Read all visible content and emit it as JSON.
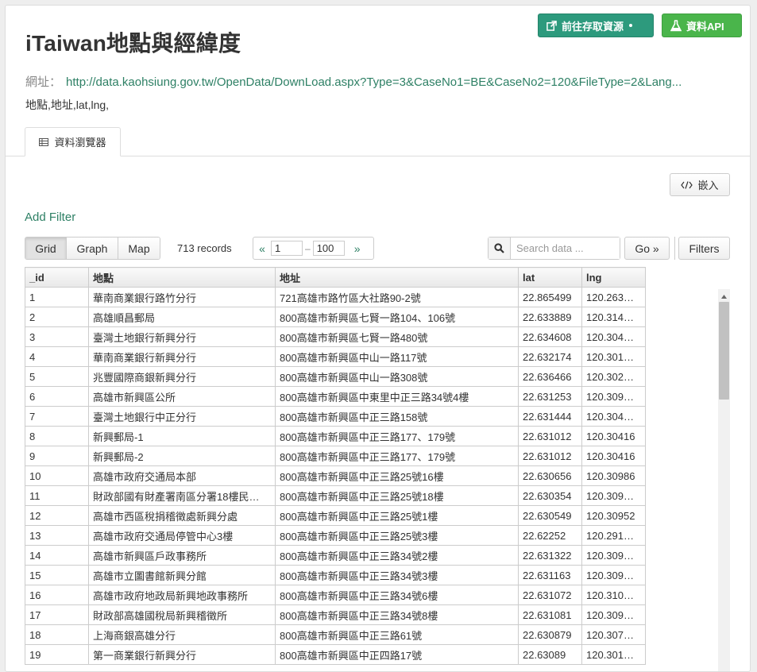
{
  "page": {
    "title": "iTaiwan地點與經緯度",
    "url_label": "網址：",
    "url": "http://data.kaohsiung.gov.tw/OpenData/DownLoad.aspx?Type=3&CaseNo1=BE&CaseNo2=120&FileType=2&Lang...",
    "fields": "地點,地址,lat,lng,"
  },
  "buttons": {
    "access": "前往存取資源",
    "api": "資料API",
    "embed": "嵌入",
    "go": "Go »",
    "filters": "Filters"
  },
  "tabs": {
    "data_explorer": "資料瀏覽器"
  },
  "toolbar": {
    "add_filter": "Add Filter",
    "views": [
      "Grid",
      "Graph",
      "Map"
    ],
    "records": "713 records",
    "pager_prev": "«",
    "pager_next": "»",
    "pager_from": "1",
    "pager_dash": "–",
    "pager_to": "100",
    "search_placeholder": "Search data ..."
  },
  "grid": {
    "columns": [
      "_id",
      "地點",
      "地址",
      "lat",
      "lng"
    ],
    "rows": [
      [
        "1",
        "華南商業銀行路竹分行",
        "721高雄市路竹區大社路90-2號",
        "22.865499",
        "120.263…"
      ],
      [
        "2",
        "高雄順昌郵局",
        "800高雄市新興區七賢一路104、106號",
        "22.633889",
        "120.314…"
      ],
      [
        "3",
        "臺灣土地銀行新興分行",
        "800高雄市新興區七賢一路480號",
        "22.634608",
        "120.304…"
      ],
      [
        "4",
        "華南商業銀行新興分行",
        "800高雄市新興區中山一路117號",
        "22.632174",
        "120.301…"
      ],
      [
        "5",
        "兆豐國際商銀新興分行",
        "800高雄市新興區中山一路308號",
        "22.636466",
        "120.302…"
      ],
      [
        "6",
        "高雄市新興區公所",
        "800高雄市新興區中東里中正三路34號4樓",
        "22.631253",
        "120.309…"
      ],
      [
        "7",
        "臺灣土地銀行中正分行",
        "800高雄市新興區中正三路158號",
        "22.631444",
        "120.304…"
      ],
      [
        "8",
        "新興郵局-1",
        "800高雄市新興區中正三路177、179號",
        "22.631012",
        "120.30416"
      ],
      [
        "9",
        "新興郵局-2",
        "800高雄市新興區中正三路177、179號",
        "22.631012",
        "120.30416"
      ],
      [
        "10",
        "高雄市政府交通局本部",
        "800高雄市新興區中正三路25號16樓",
        "22.630656",
        "120.30986"
      ],
      [
        "11",
        "財政部國有財產署南區分署18樓民…",
        "800高雄市新興區中正三路25號18樓",
        "22.630354",
        "120.309…"
      ],
      [
        "12",
        "高雄市西區稅捐稽徵處新興分處",
        "800高雄市新興區中正三路25號1樓",
        "22.630549",
        "120.30952"
      ],
      [
        "13",
        "高雄市政府交通局停管中心3樓",
        "800高雄市新興區中正三路25號3樓",
        "22.62252",
        "120.291…"
      ],
      [
        "14",
        "高雄市新興區戶政事務所",
        "800高雄市新興區中正三路34號2樓",
        "22.631322",
        "120.309…"
      ],
      [
        "15",
        "高雄市立圖書館新興分館",
        "800高雄市新興區中正三路34號3樓",
        "22.631163",
        "120.309…"
      ],
      [
        "16",
        "高雄市政府地政局新興地政事務所",
        "800高雄市新興區中正三路34號6樓",
        "22.631072",
        "120.310…"
      ],
      [
        "17",
        "財政部高雄國稅局新興稽徵所",
        "800高雄市新興區中正三路34號8樓",
        "22.631081",
        "120.309…"
      ],
      [
        "18",
        "上海商銀高雄分行",
        "800高雄市新興區中正三路61號",
        "22.630879",
        "120.307…"
      ],
      [
        "19",
        "第一商業銀行新興分行",
        "800高雄市新興區中正四路17號",
        "22.63089",
        "120.301…"
      ]
    ]
  },
  "colors": {
    "primary_green": "#2d9a7d",
    "api_green": "#4ab54b",
    "link_green": "#2e8065"
  },
  "icons": [
    "external-link-icon",
    "caret-down-icon",
    "flask-icon",
    "table-icon",
    "code-icon",
    "search-icon",
    "scroll-up-icon"
  ]
}
